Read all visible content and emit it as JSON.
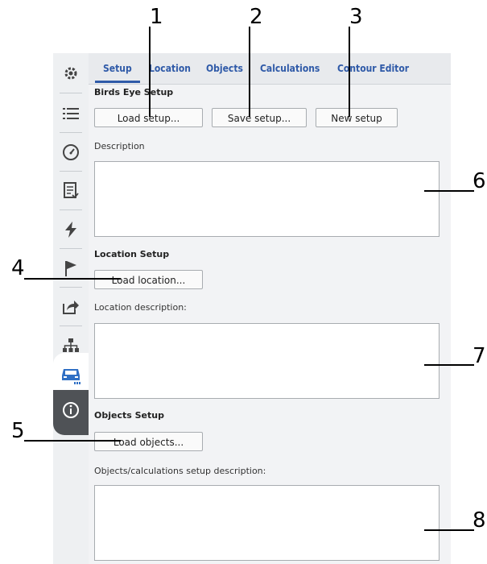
{
  "callouts": [
    "1",
    "2",
    "3",
    "4",
    "5",
    "6",
    "7",
    "8"
  ],
  "tabs": [
    "Setup",
    "Location",
    "Objects",
    "Calculations",
    "Contour Editor"
  ],
  "rail_icons": [
    "gear-icon",
    "list-icon",
    "gauge-icon",
    "report-icon",
    "lightning-icon",
    "flag-icon",
    "export-icon",
    "hierarchy-icon",
    "car-icon",
    "info-icon"
  ],
  "birds_eye": {
    "title": "Birds Eye Setup",
    "load_setup": "Load setup...",
    "save_setup": "Save setup...",
    "new_setup": "New setup",
    "description_label": "Description",
    "description_value": ""
  },
  "location": {
    "title": "Location Setup",
    "load_location": "Load location...",
    "description_label": "Location description:",
    "description_value": ""
  },
  "objects": {
    "title": "Objects Setup",
    "load_objects": "Load objects...",
    "description_label": "Objects/calculations setup description:",
    "description_value": ""
  },
  "colors": {
    "tab_text": "#2f5aa8",
    "active_icon": "#2f6fc4",
    "dark_rail": "#4f5256"
  }
}
